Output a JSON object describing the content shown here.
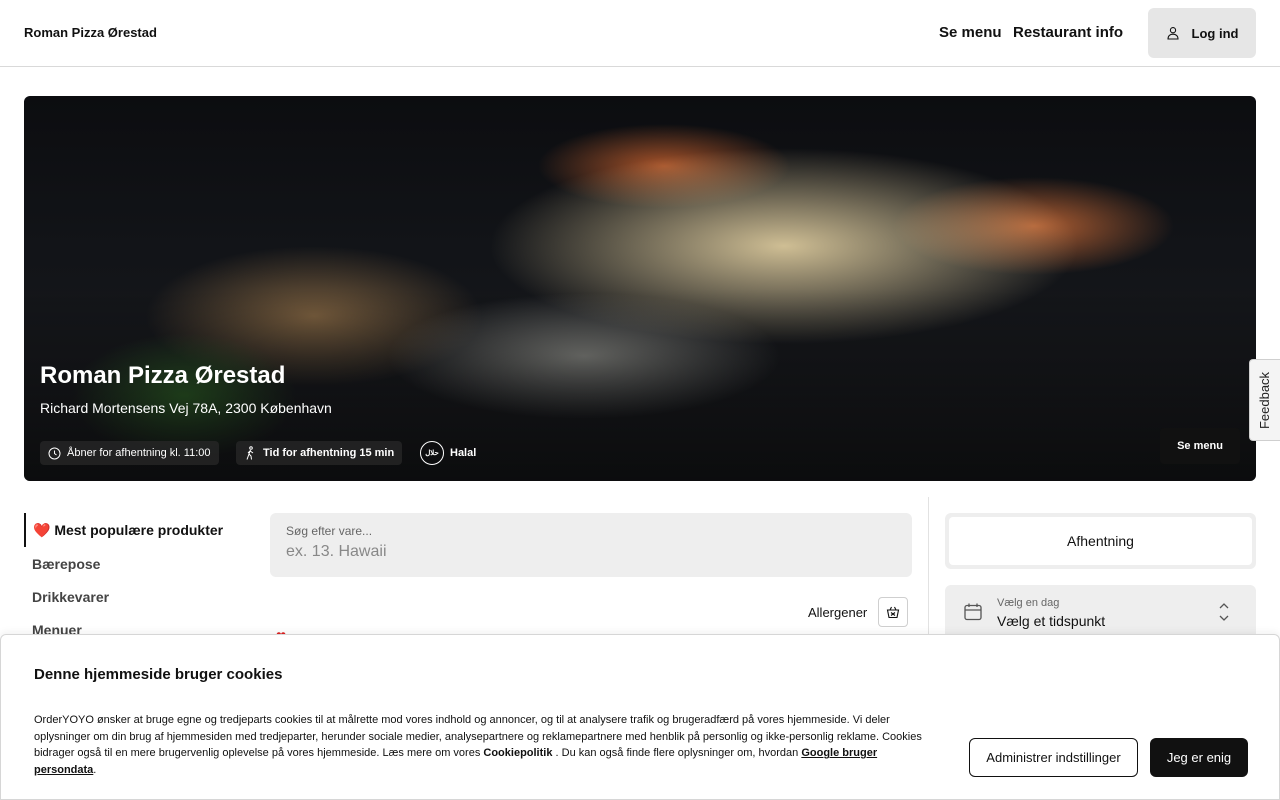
{
  "header": {
    "brand": "Roman Pizza Ørestad",
    "nav": {
      "menu": "Se menu",
      "info": "Restaurant info"
    },
    "login_label": "Log ind"
  },
  "hero": {
    "title": "Roman Pizza Ørestad",
    "address": "Richard Mortensens Vej 78A, 2300 København",
    "open_chip": "Åbner for afhentning kl. 11:00",
    "pickup_time_chip": "Tid for afhentning 15 min",
    "halal_chip": "Halal",
    "halal_badge_text": "حلال",
    "menu_button": "Se menu"
  },
  "feedback_label": "Feedback",
  "categories": [
    {
      "label": "❤️ Mest populære produkter",
      "active": true
    },
    {
      "label": "Bærepose",
      "active": false
    },
    {
      "label": "Drikkevarer",
      "active": false
    },
    {
      "label": "Menuer",
      "active": false
    }
  ],
  "search": {
    "label": "Søg efter vare...",
    "placeholder": "ex. 13. Hawaii"
  },
  "allergen_label": "Allergener",
  "order_panel": {
    "pickup_label": "Afhentning",
    "day_label": "Vælg en dag",
    "time_value": "Vælg et tidspunkt"
  },
  "cookie": {
    "title": "Denne hjemmeside bruger cookies",
    "text_1": "OrderYOYO ønsker at bruge egne og tredjeparts cookies til at målrette mod vores indhold og annoncer, og til at analysere trafik og brugeradfærd på vores hjemmeside. Vi deler oplysninger om din brug af hjemmesiden med tredjeparter, herunder sociale medier, analysepartnere og reklamepartnere med henblik på personlig og ikke-personlig reklame. Cookies bidrager også til en mere brugervenlig oplevelse på vores hjemmeside. Læs mere om vores ",
    "link_cookie": "Cookiepolitik",
    "text_2": " . Du kan også finde flere oplysninger om, hvordan ",
    "link_google": "Google bruger persondata",
    "text_3": ".",
    "manage_button": "Administrer indstillinger",
    "agree_button": "Jeg er enig"
  },
  "colors": {
    "accent": "#111111",
    "surface": "#eeeeee",
    "heart": "#dd2222"
  }
}
